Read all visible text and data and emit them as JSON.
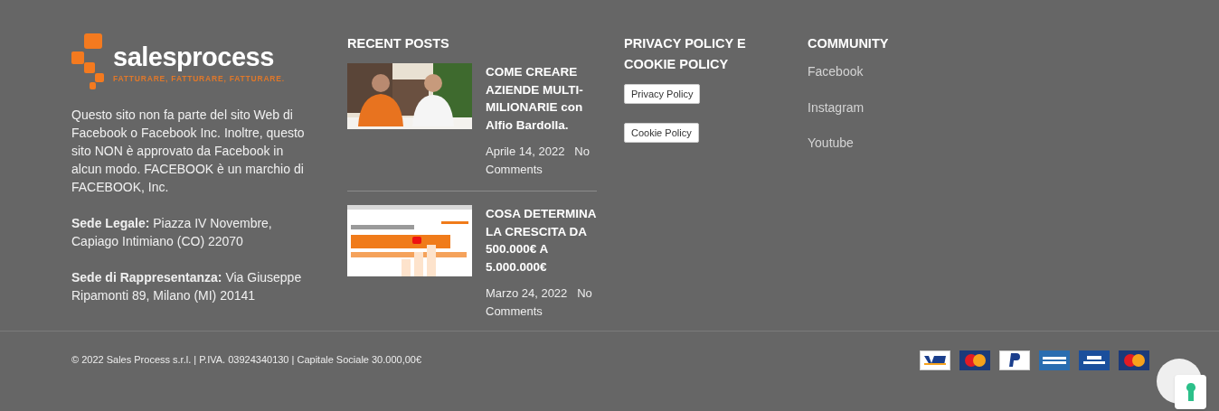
{
  "brand": {
    "name": "salesprocess",
    "tagline": "FATTURARE, FATTURARE, FATTURARE."
  },
  "about": {
    "disclaimer": "Questo sito non fa parte del sito Web di Facebook o Facebook Inc. Inoltre, questo sito NON è approvato da Facebook in alcun modo. FACEBOOK è un marchio di FACEBOOK, Inc.",
    "addresses": [
      {
        "label": "Sede Legale:",
        "text": "Piazza IV Novembre, Capiago Intimiano (CO) 22070"
      },
      {
        "label": "Sede di Rappresentanza:",
        "text": "Via Giuseppe Ripamonti 89, Milano (MI) 20141"
      }
    ]
  },
  "recent_posts": {
    "heading": "RECENT POSTS",
    "posts": [
      {
        "title": "COME CREARE AZIENDE MULTI-MILIONARIE con Alfio Bardolla.",
        "date": "Aprile 14, 2022",
        "comments": "No Comments"
      },
      {
        "title": "COSA DETERMINA LA CRESCITA DA 500.000€ A 5.000.000€",
        "date": "Marzo 24, 2022",
        "comments": "No Comments"
      }
    ]
  },
  "privacy": {
    "heading": "PRIVACY POLICY E COOKIE POLICY",
    "buttons": [
      "Privacy Policy",
      "Cookie Policy"
    ]
  },
  "community": {
    "heading": "COMMUNITY",
    "links": [
      "Facebook",
      "Instagram",
      "Youtube"
    ]
  },
  "bottom_bar": {
    "copyright": "© 2022 Sales Process s.r.l. | P.IVA. 03924340130 | Capitale Sociale 30.000,00€",
    "payment_cards": [
      {
        "kind": "visa"
      },
      {
        "kind": "mastercard"
      },
      {
        "kind": "paypal"
      },
      {
        "kind": "amex"
      },
      {
        "kind": "electron"
      },
      {
        "kind": "maestro"
      }
    ]
  }
}
